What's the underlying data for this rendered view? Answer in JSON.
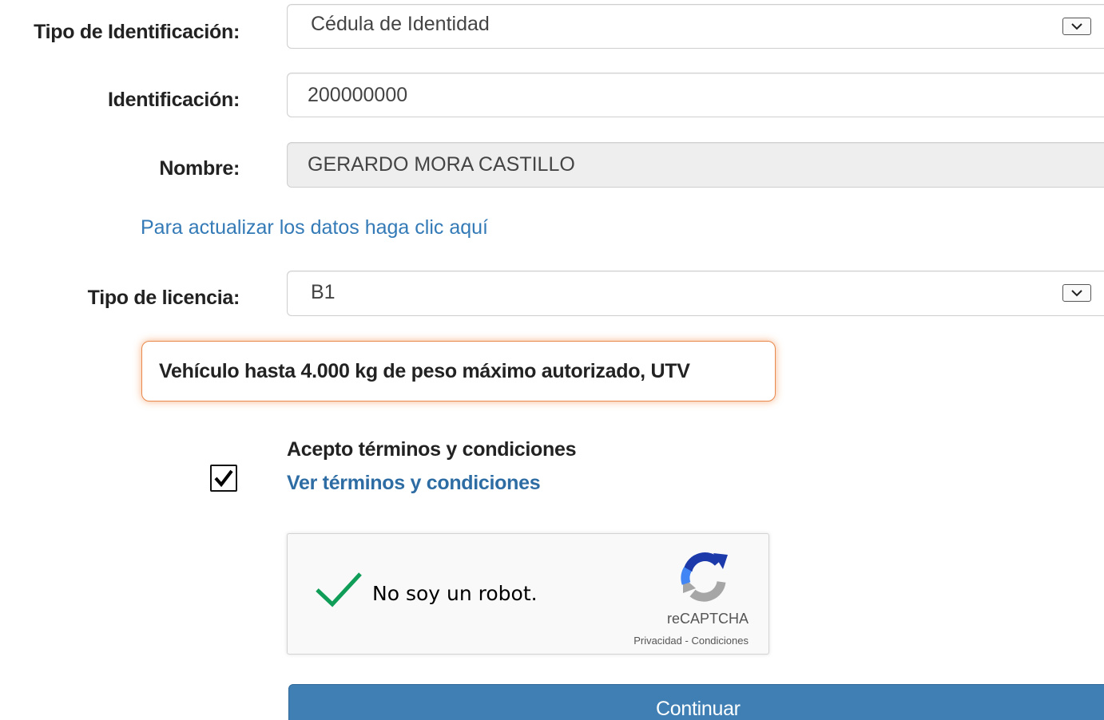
{
  "form": {
    "id_type": {
      "label": "Tipo de Identificación:",
      "value": "Cédula de Identidad"
    },
    "identification": {
      "label": "Identificación:",
      "value": "200000000"
    },
    "name": {
      "label": "Nombre:",
      "value": "GERARDO MORA CASTILLO"
    },
    "update_link": "Para actualizar los datos haga clic aquí",
    "license_type": {
      "label": "Tipo de licencia:",
      "value": "B1"
    },
    "license_description": "Vehículo hasta 4.000 kg de peso máximo autorizado, UTV",
    "terms": {
      "checked": true,
      "accept_label": "Acepto términos y condiciones",
      "view_link": "Ver términos y condiciones"
    },
    "recaptcha": {
      "label": "No soy un robot.",
      "brand": "reCAPTCHA",
      "privacy": "Privacidad",
      "separator": " - ",
      "conditions": "Condiciones",
      "verified": true
    },
    "submit_label": "Continuar"
  },
  "colors": {
    "link": "#337ab7",
    "button": "#3f7fb3",
    "info_border": "#e8884c",
    "check_green": "#0f9d58"
  },
  "icons": {
    "select_arrow": "chevron-down-icon",
    "checkbox_mark": "checkmark-icon",
    "recaptcha_check": "check-icon",
    "recaptcha_logo": "recaptcha-logo-icon"
  }
}
